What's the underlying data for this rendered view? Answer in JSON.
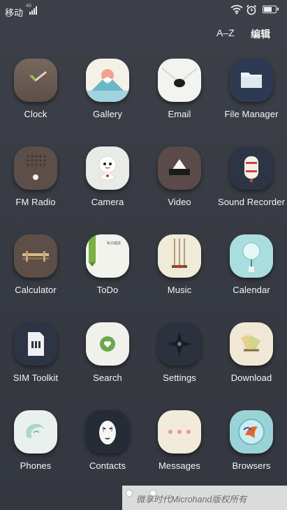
{
  "status_bar": {
    "carrier": "移动",
    "signal_label": "4G",
    "icons": [
      "signal-icon",
      "wifi-icon",
      "alarm-icon",
      "battery-icon"
    ],
    "battery_level": 0.75
  },
  "top_bar": {
    "sort_label": "A–Z",
    "edit_label": "编辑"
  },
  "apps": [
    {
      "label": "Clock",
      "icon": "clock-icon"
    },
    {
      "label": "Gallery",
      "icon": "gallery-icon"
    },
    {
      "label": "Email",
      "icon": "email-icon"
    },
    {
      "label": "File Manager",
      "icon": "folder-icon"
    },
    {
      "label": "FM Radio",
      "icon": "radio-icon"
    },
    {
      "label": "Camera",
      "icon": "camera-icon"
    },
    {
      "label": "Video",
      "icon": "video-icon"
    },
    {
      "label": "Sound Recorder",
      "icon": "recorder-icon"
    },
    {
      "label": "Calculator",
      "icon": "calculator-icon"
    },
    {
      "label": "ToDo",
      "icon": "todo-icon"
    },
    {
      "label": "Music",
      "icon": "music-icon"
    },
    {
      "label": "Calendar",
      "icon": "calendar-icon"
    },
    {
      "label": "SIM Toolkit",
      "icon": "sim-icon"
    },
    {
      "label": "Search",
      "icon": "search-icon"
    },
    {
      "label": "Settings",
      "icon": "settings-icon"
    },
    {
      "label": "Download",
      "icon": "download-icon"
    },
    {
      "label": "Phones",
      "icon": "phone-icon"
    },
    {
      "label": "Contacts",
      "icon": "contacts-icon"
    },
    {
      "label": "Messages",
      "icon": "messages-icon"
    },
    {
      "label": "Browsers",
      "icon": "browser-icon"
    }
  ],
  "todo_icon_text": "私の面談",
  "watermark": {
    "text": "微享时代Microhand版权所有"
  }
}
